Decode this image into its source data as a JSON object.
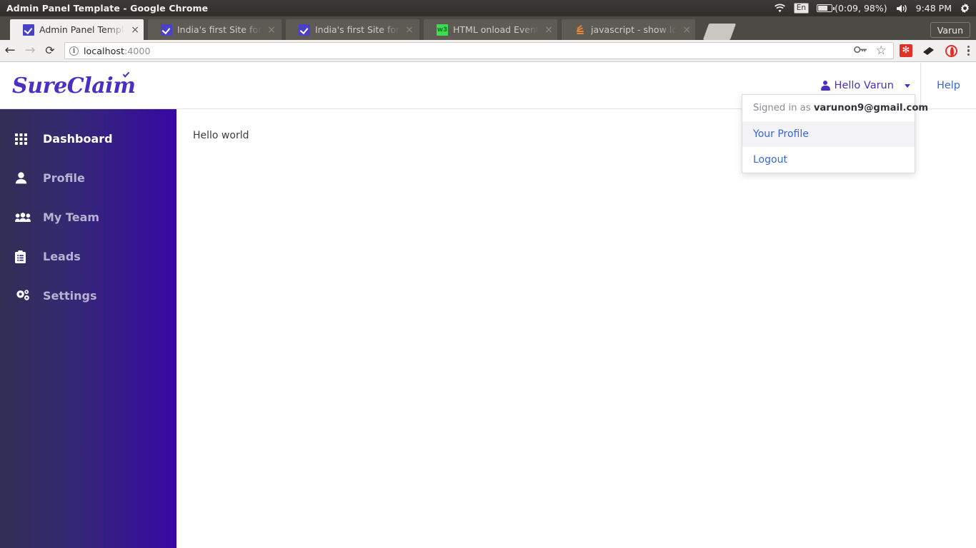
{
  "os_panel": {
    "window_title": "Admin Panel Template - Google Chrome",
    "tray": {
      "wifi_icon": "wifi-icon",
      "language": "En",
      "battery": "(0:09, 98%)",
      "volume_icon": "volume-icon",
      "clock": "9:48 PM",
      "settings_icon": "gear-icon"
    }
  },
  "browser": {
    "tabs": [
      {
        "title": "Admin Panel Template",
        "favicon": "checkmark-favicon",
        "active": true,
        "close_label": "×"
      },
      {
        "title": "India's first Site for",
        "favicon": "checkmark-favicon",
        "active": false,
        "close_label": "×"
      },
      {
        "title": "India's first Site for",
        "favicon": "checkmark-favicon",
        "active": false,
        "close_label": "×"
      },
      {
        "title": "HTML onload Event",
        "favicon": "w3schools-favicon",
        "active": false,
        "close_label": "×"
      },
      {
        "title": "javascript - show lo",
        "favicon": "stackoverflow-favicon",
        "active": false,
        "close_label": "×"
      }
    ],
    "new_tab_label": "",
    "profile_button": "Varun",
    "toolbar": {
      "back_glyph": "←",
      "forward_glyph": "→",
      "reload_glyph": "⟳",
      "site_info_glyph": "i",
      "url_host": "localhost",
      "url_rest": ":4000",
      "url_full": "localhost:4000",
      "key_icon": "password-key-icon",
      "star_glyph": "☆",
      "extensions": [
        "red-square-extension-icon",
        "black-extension-icon",
        "opera-extension-icon"
      ],
      "menu_icon": "kebab-menu-icon"
    }
  },
  "app": {
    "brand": "SureClaim",
    "header": {
      "user_menu_label": "Hello Varun",
      "help_label": "Help"
    },
    "dropdown": {
      "signed_in_prefix": "Signed in as ",
      "email": "varunon9@gmail.com",
      "items": [
        {
          "label": "Your Profile",
          "hover": true
        },
        {
          "label": "Logout",
          "hover": false
        }
      ]
    },
    "sidebar": {
      "items": [
        {
          "label": "Dashboard",
          "icon": "grid-icon",
          "active": true
        },
        {
          "label": "Profile",
          "icon": "user-icon",
          "active": false
        },
        {
          "label": "My Team",
          "icon": "users-icon",
          "active": false
        },
        {
          "label": "Leads",
          "icon": "clipboard-icon",
          "active": false
        },
        {
          "label": "Settings",
          "icon": "cogs-icon",
          "active": false
        }
      ]
    },
    "content": {
      "text": "Hello world"
    }
  },
  "colors": {
    "brand_purple": "#4a2fc4",
    "link_blue": "#3866d6",
    "sidebar_gradient_start": "#332e54",
    "sidebar_gradient_end": "#3708a4",
    "tab_active_bg": "#f1f0ee"
  }
}
